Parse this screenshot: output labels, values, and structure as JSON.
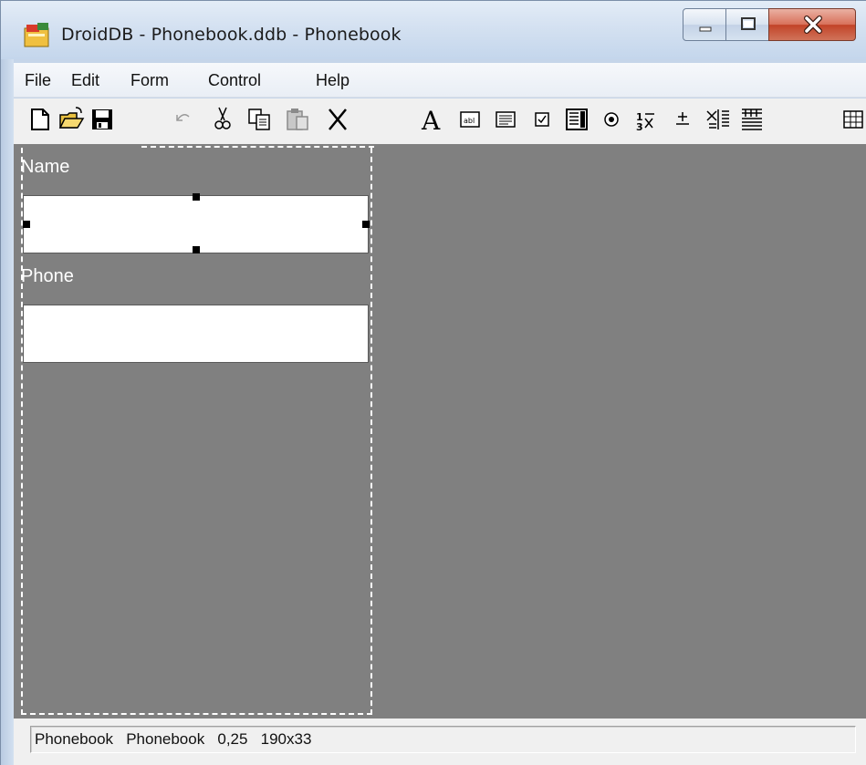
{
  "window": {
    "title": "DroidDB - Phonebook.ddb - Phonebook",
    "controls": [
      "minimize-icon",
      "maximize-icon",
      "close-icon"
    ]
  },
  "menubar": {
    "items": [
      "File",
      "Edit",
      "Form",
      "Control",
      "Help"
    ]
  },
  "toolbar": {
    "buttons": [
      {
        "name": "new-icon"
      },
      {
        "name": "open-folder-icon"
      },
      {
        "name": "save-disk-icon"
      },
      {
        "name": "undo-icon",
        "disabled": true
      },
      {
        "name": "cut-icon"
      },
      {
        "name": "copy-icon"
      },
      {
        "name": "paste-icon",
        "disabled": true
      },
      {
        "name": "delete-icon"
      },
      {
        "name": "label-tool-icon",
        "glyph": "A"
      },
      {
        "name": "textbox-tool-icon"
      },
      {
        "name": "multiline-tool-icon"
      },
      {
        "name": "checkbox-tool-icon"
      },
      {
        "name": "listbox-tool-icon"
      },
      {
        "name": "radio-tool-icon"
      },
      {
        "name": "numeric-tool-icon"
      },
      {
        "name": "spin-tool-icon"
      },
      {
        "name": "align-tool-icon"
      },
      {
        "name": "grid-tool-icon"
      },
      {
        "name": "table-tool-icon"
      }
    ]
  },
  "form": {
    "fields": [
      {
        "label": "Name",
        "value": ""
      },
      {
        "label": "Phone",
        "value": ""
      }
    ]
  },
  "statusbar": {
    "text": "Phonebook   Phonebook   0,25   190x33"
  },
  "colors": {
    "workarea": "#808080",
    "form_label": "#ffffff",
    "chrome": "#f0f0f0"
  }
}
